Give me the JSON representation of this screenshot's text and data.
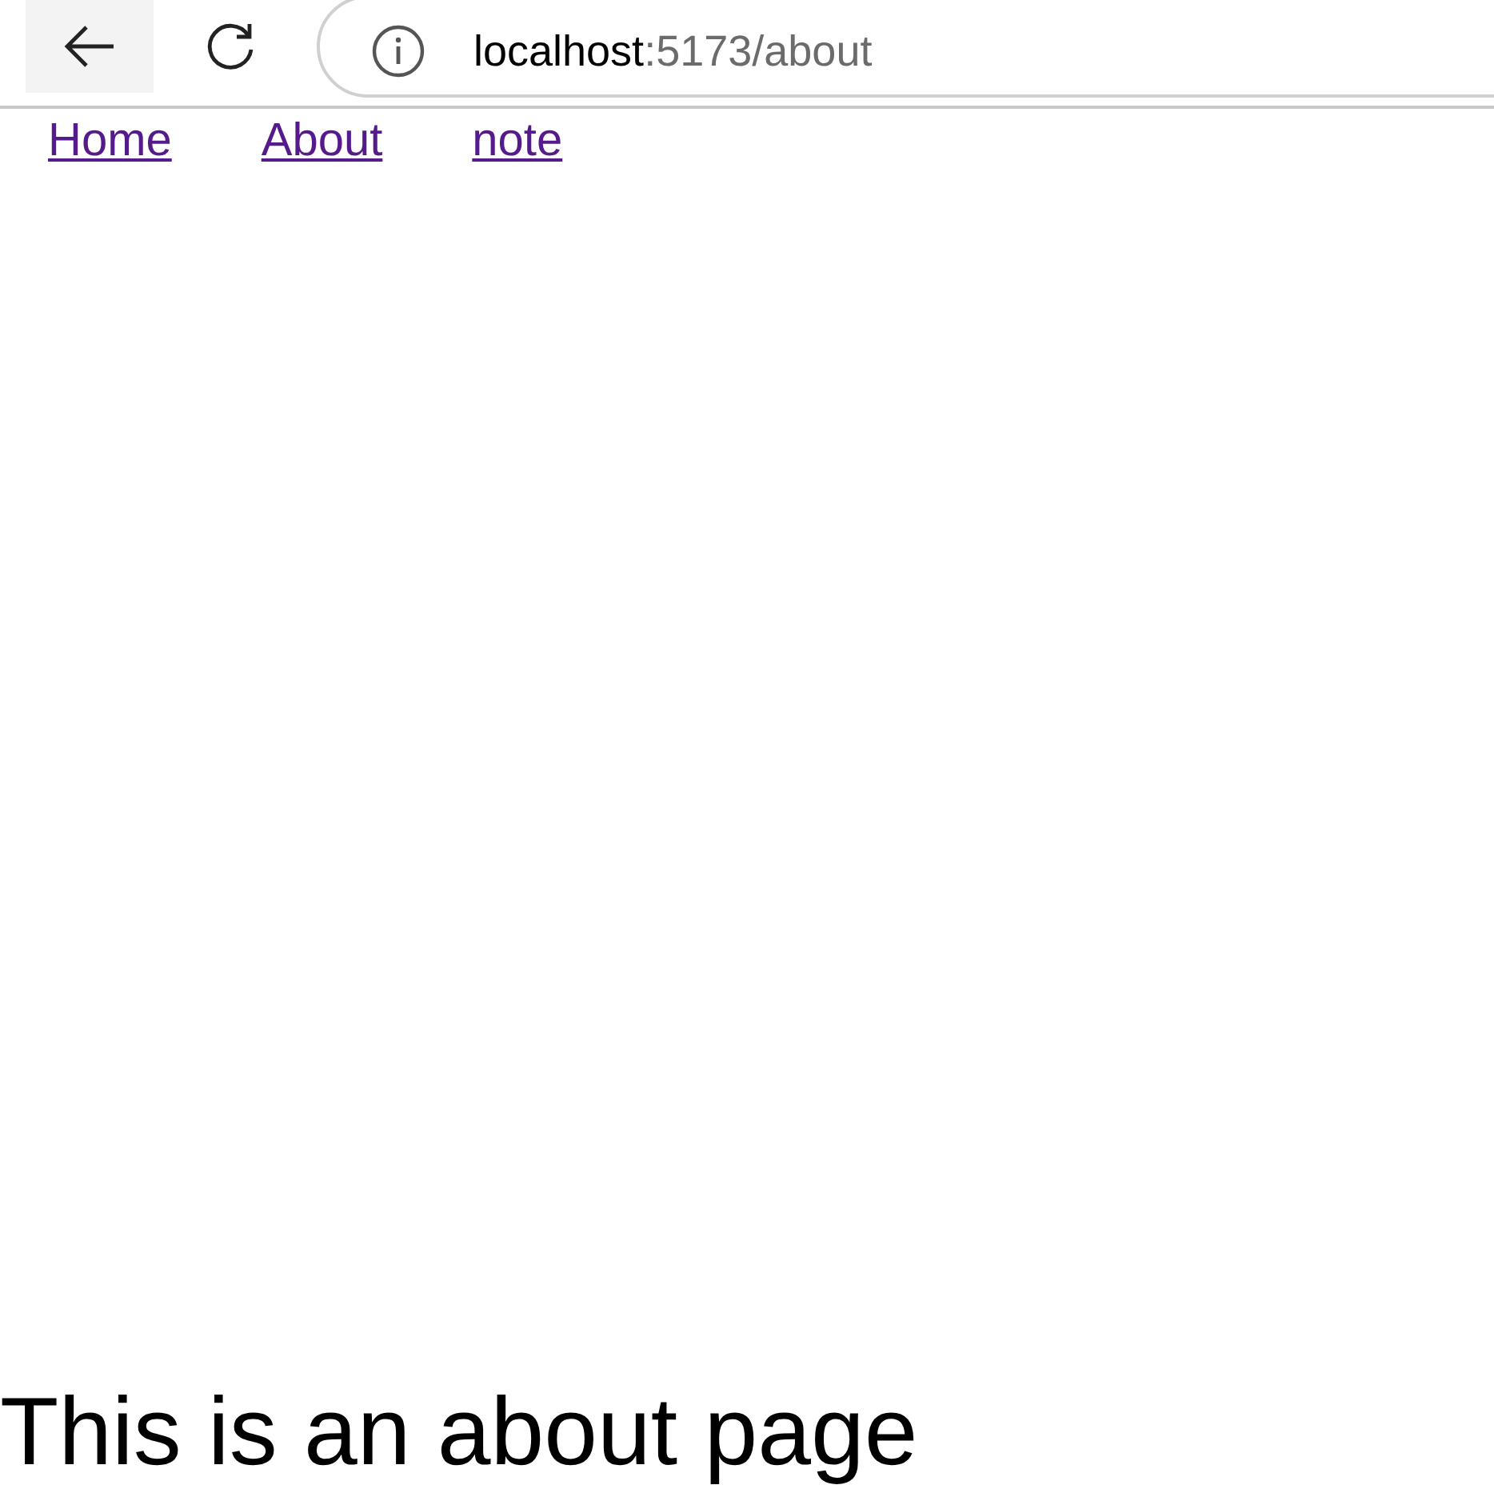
{
  "address_bar": {
    "host": "localhost",
    "path": ":5173/about"
  },
  "nav_links": [
    {
      "label": "Home"
    },
    {
      "label": "About"
    },
    {
      "label": "note"
    }
  ],
  "heading": "This is an about page"
}
